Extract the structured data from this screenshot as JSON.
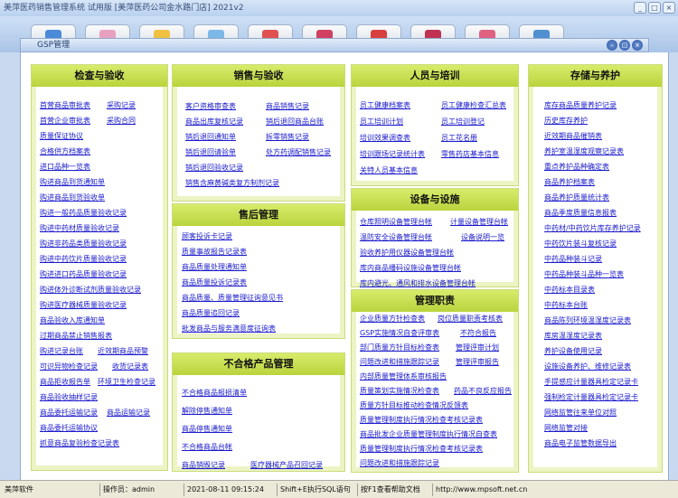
{
  "app": {
    "title": "美萍医药销售管理系统 试用版 [美萍医药公司金水路门店] 2021v2"
  },
  "window_buttons": [
    "_",
    "□",
    "×"
  ],
  "gsp_window": {
    "title": "GSP管理",
    "buttons": [
      "–",
      "□",
      "×"
    ]
  },
  "panels": {
    "inspection": {
      "title": "检查与验收",
      "items": [
        "首营商品审批表",
        "采购记录",
        "首营企业审批表",
        "采购合同",
        "质量保证协议",
        "合格供方档案表",
        "进口品种一览表",
        "购进商品到货通知单",
        "购进商品到货验收单",
        "购进一般药品质量验收记录",
        "购进中药材质量验收记录",
        "购进非药品类质量验收记录",
        "购进中药饮片质量验收记录",
        "购进进口药品质量验收记录",
        "购进体外诊断试剂质量验收记录",
        "购进医疗器械质量验收记录",
        "商品验收入库通知单",
        "过期商品禁止销售报表",
        "购进记录台账",
        "近效期商品预警",
        "可识异物检查记录",
        "收货记录表",
        "商品拒收报告单",
        "环境卫生检查记录",
        "商品验收抽样记录",
        "商品委托运输记录",
        "商品运输记录",
        "商品委托运输协议",
        "抓意商品复验检查记录表"
      ]
    },
    "sales": {
      "title": "销售与验收",
      "items": [
        "客户资格审查表",
        "商品销售记录",
        "商品出库复核记录",
        "销后退回商品台账",
        "销后退回通知单",
        "拆零销售记录",
        "销后退回请验单",
        "处方药调配销售记录",
        "销后退回验收记录",
        "销售含麻黄碱类复方制剂记录"
      ]
    },
    "aftersale": {
      "title": "售后管理",
      "items": [
        "顾客投诉卡记录",
        "质量事故报告记录表",
        "商品质量处理通知单",
        "商品质量投诉记录表",
        "商品质量、质量管理征询意见书",
        "商品质量追回记录",
        "批发商品与服务满意度征询表"
      ]
    },
    "nonconform": {
      "title": "不合格产品管理",
      "items": [
        "不合格商品报损清单",
        "解除停售通知单",
        "商品停售通知单",
        "不合格商品台帐",
        "商品销毁记录",
        "医疗器械产品召回记录"
      ]
    },
    "staff": {
      "title": "人员与培训",
      "items": [
        "员工健康档案表",
        "员工健康检查汇总表",
        "员工培训计划",
        "员工培训登记",
        "培训效果调查表",
        "员工花名册",
        "培训跟场记录统计表",
        "零售药店基本信息",
        "关特人员基本信息"
      ]
    },
    "equipment": {
      "title": "设备与设施",
      "items": [
        "仓库照明设备管理台帐",
        "计量设备管理台帐",
        "温防安全设备管理台帐",
        "设备说明一览",
        "验收养护用仪器设备管理台帐",
        "库内商品播码设施设备管理台帐",
        "库内避光、通风和排水设备管理台帐"
      ]
    },
    "duty": {
      "title": "管理职责",
      "items": [
        "企业质量方针检查表",
        "岗位质量职责考核表",
        "GSP实施情况自查评审表",
        "不符合报告",
        "部门质量方针目标检查表",
        "管理评审计划",
        "问题改进和措施跟踪记录",
        "管理评审报告",
        "内部质量管理体系审核报告",
        "质量策划实施情况检查表",
        "药品不良反应报告",
        "质量方针目标推动检查情况反馈表",
        "质量管理制度执行情况检查考核记录表",
        "商品批发企业质量管理制度执行情况自查表",
        "质量管理制度执行情况检查考核记录表",
        "问题改进和措施跟踪记录"
      ]
    },
    "storage": {
      "title": "存储与养护",
      "items": [
        "库存商品质量养护记录",
        "历史库存养护",
        "近效期商品催销表",
        "养护室温湿度观察记录表",
        "重点养护品种确定表",
        "商品养护档案表",
        "商品养护质量统计表",
        "商品季度质量信息报表",
        "中药材/中药饮片库存养护记录",
        "中药饮片装斗复核记录",
        "中药品种装斗记录",
        "中药品种装斗品种一览表",
        "中药标本目录表",
        "中药标本台账",
        "商品陈列环境温湿度记录表",
        "库房温湿度记录表",
        "养护设备使用记录",
        "设施设备养护、维修记录表",
        "手提感应计量器具检定记录卡",
        "强制检定计量器具检定记录卡",
        "网络监管往来单位对照",
        "网络监管对接",
        "商品电子监管数据导出"
      ]
    }
  },
  "statusbar": [
    "美萍软件",
    "操作员：admin",
    "2021-08-11 09:15:24",
    "Shift+E执行SQL语句",
    "按F1查看帮助文档",
    "http://www.mpsoft.net.cn"
  ]
}
